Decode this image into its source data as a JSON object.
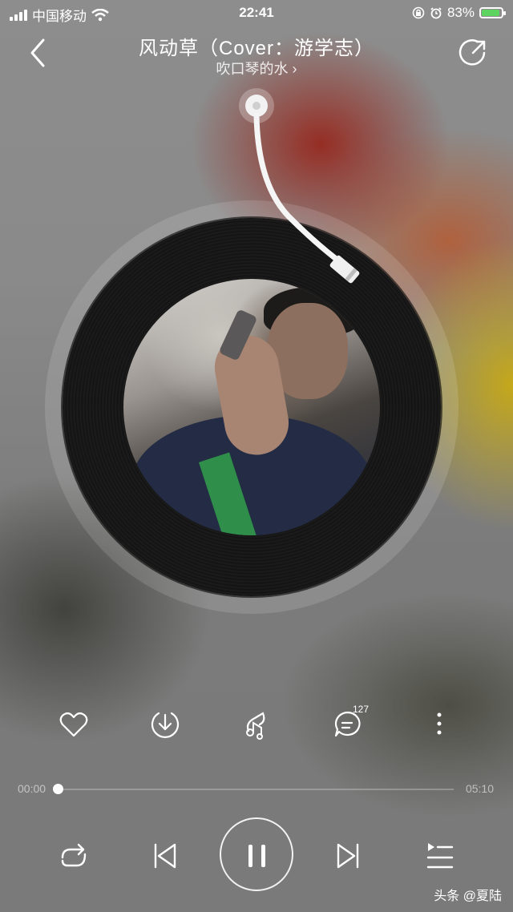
{
  "status_bar": {
    "carrier": "中国移动",
    "time": "22:41",
    "battery": "83%",
    "battery_level": 0.83
  },
  "header": {
    "title": "风动草（Cover：游学志）",
    "artist": "吹口琴的水 ›"
  },
  "actions": {
    "comment_count": "127"
  },
  "progress": {
    "current": "00:00",
    "total": "05:10",
    "fraction": 0.0
  },
  "watermark": "头条 @夏陆",
  "colors": {
    "accent_red": "#962820",
    "accent_yellow": "#c8aa14",
    "battery_green": "#5fd35f"
  },
  "icons": [
    "back-icon",
    "share-icon",
    "heart-icon",
    "download-icon",
    "music-effect-icon",
    "comment-icon",
    "more-icon",
    "repeat-icon",
    "previous-icon",
    "pause-icon",
    "next-icon",
    "playlist-icon",
    "wifi-icon",
    "lock-rotation-icon",
    "alarm-icon"
  ]
}
